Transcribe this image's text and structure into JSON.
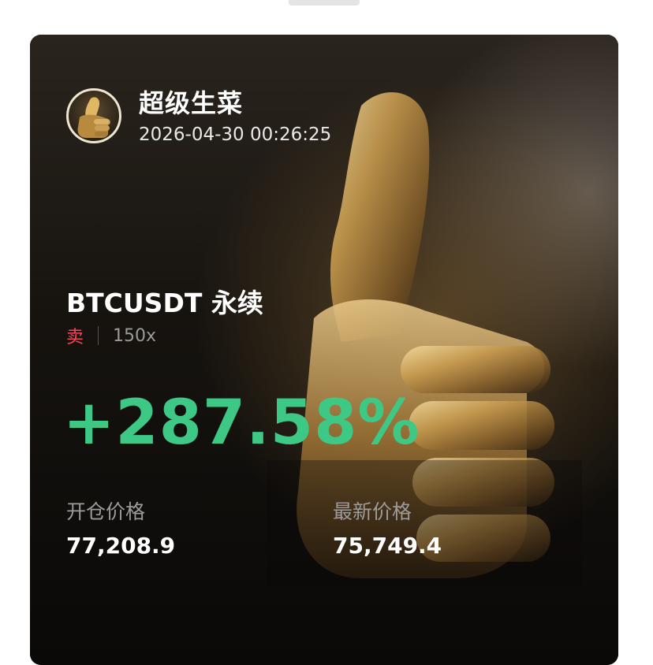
{
  "user": {
    "name": "超级生菜",
    "timestamp": "2026-04-30 00:26:25"
  },
  "position": {
    "symbol": "BTCUSDT 永续",
    "side": "卖",
    "leverage": "150x",
    "pnl_percent": "+287.58%"
  },
  "prices": {
    "entry_label": "开仓价格",
    "entry_value": "77,208.9",
    "latest_label": "最新价格",
    "latest_value": "75,749.4"
  },
  "colors": {
    "profit": "#3ec885",
    "sell": "#f6465d",
    "background": "#0b0a09"
  },
  "icons": {
    "avatar": "thumbs-up-avatar-icon",
    "background_art": "golden-thumbs-up-icon"
  }
}
